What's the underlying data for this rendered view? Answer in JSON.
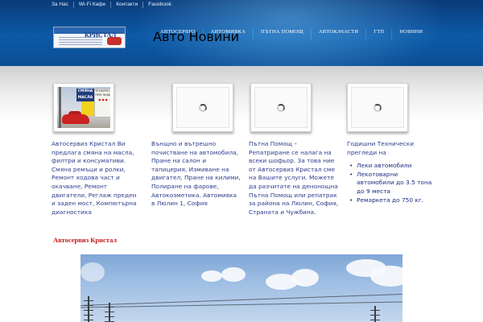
{
  "topbar": {
    "links": [
      "За Нас",
      "Wi-Fi Кафе",
      "Контакти",
      "Facebook"
    ]
  },
  "logo": {
    "brand": "КРИСТАЛ"
  },
  "nav": {
    "items": [
      "Автосервиз",
      "Автомивка",
      "Пътна помощ",
      "Автокачасти",
      "ГТП",
      "Новини"
    ],
    "sub_item": "Авто Новини"
  },
  "thumbs": {
    "photo_sign_1": "СМЯНА МАСЛА",
    "photo_sign_2": "ТЕХНИЧЕСКИ ПРЕГЛЕДИ"
  },
  "columns": {
    "col1": "Автосервиз Кристал Ви предлага смяна на масла, филтри и консумативи. Смяна ремъци и ролки, Ремонт ходова част и окачване, Ремонт двигатели, Реглаж преден и заден мост, Компютърна диагностика",
    "col2": "Вънщно и вътрешно почистване на автомобила, Пране на салон и тапицерия, Измиване на двигател, Пране на килими, Полиране на фарове, Автокозметика.  Автомивка в Люлин 1, София",
    "col3": "Пътна Помощ – Репатриране се налага на всеки шофьор. За това ние от Автосервиз Кристал сме на Вашите услуги. Можете да разчитате на денонощна Пътна Помощ или репатрак за района на Люлин, София, Страната и Чужбина.",
    "col4": {
      "intro": "Годишни Технически прегледи на",
      "bullets": [
        "Леки автомобили",
        "Лекотоварни автомобили до 3.5 тона до 9 места",
        "Ремаркета до 750 кг."
      ]
    }
  },
  "section": {
    "title": "Автосервиз Кристал"
  },
  "colors": {
    "header_dark": "#0a3a78",
    "header_light": "#0d5aa8",
    "body_text": "#2e3d8c",
    "section_title": "#c41a1a"
  }
}
